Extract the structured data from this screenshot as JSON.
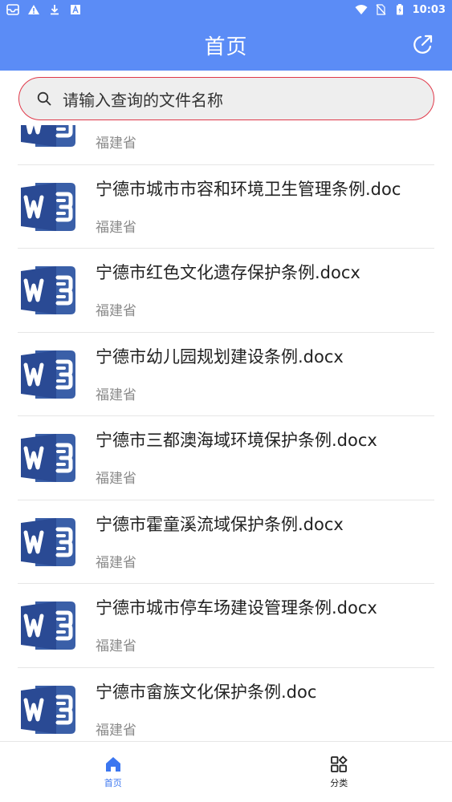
{
  "status_bar": {
    "time": "10:03",
    "left_icons": [
      "inbox-icon",
      "warning-icon",
      "download-icon",
      "font-icon"
    ],
    "right_icons": [
      "wifi-icon",
      "no-sim-icon",
      "battery-icon"
    ]
  },
  "header": {
    "title": "首页",
    "action_icon": "share-icon",
    "background_color": "#5b8cf6"
  },
  "search": {
    "placeholder": "请输入查询的文件名称",
    "border_color": "#e0394a"
  },
  "documents": [
    {
      "title": "",
      "region": "福建省",
      "icon": "word-doc-icon"
    },
    {
      "title": "宁德市城市市容和环境卫生管理条例.doc",
      "region": "福建省",
      "icon": "word-doc-icon"
    },
    {
      "title": "宁德市红色文化遗存保护条例.docx",
      "region": "福建省",
      "icon": "word-doc-icon"
    },
    {
      "title": "宁德市幼儿园规划建设条例.docx",
      "region": "福建省",
      "icon": "word-doc-icon"
    },
    {
      "title": "宁德市三都澳海域环境保护条例.docx",
      "region": "福建省",
      "icon": "word-doc-icon"
    },
    {
      "title": "宁德市霍童溪流域保护条例.docx",
      "region": "福建省",
      "icon": "word-doc-icon"
    },
    {
      "title": "宁德市城市停车场建设管理条例.docx",
      "region": "福建省",
      "icon": "word-doc-icon"
    },
    {
      "title": "宁德市畲族文化保护条例.doc",
      "region": "福建省",
      "icon": "word-doc-icon"
    }
  ],
  "bottom_nav": {
    "items": [
      {
        "label": "首页",
        "icon": "home-icon",
        "active": true
      },
      {
        "label": "分类",
        "icon": "category-icon",
        "active": false
      }
    ],
    "active_color": "#3b76f0"
  }
}
